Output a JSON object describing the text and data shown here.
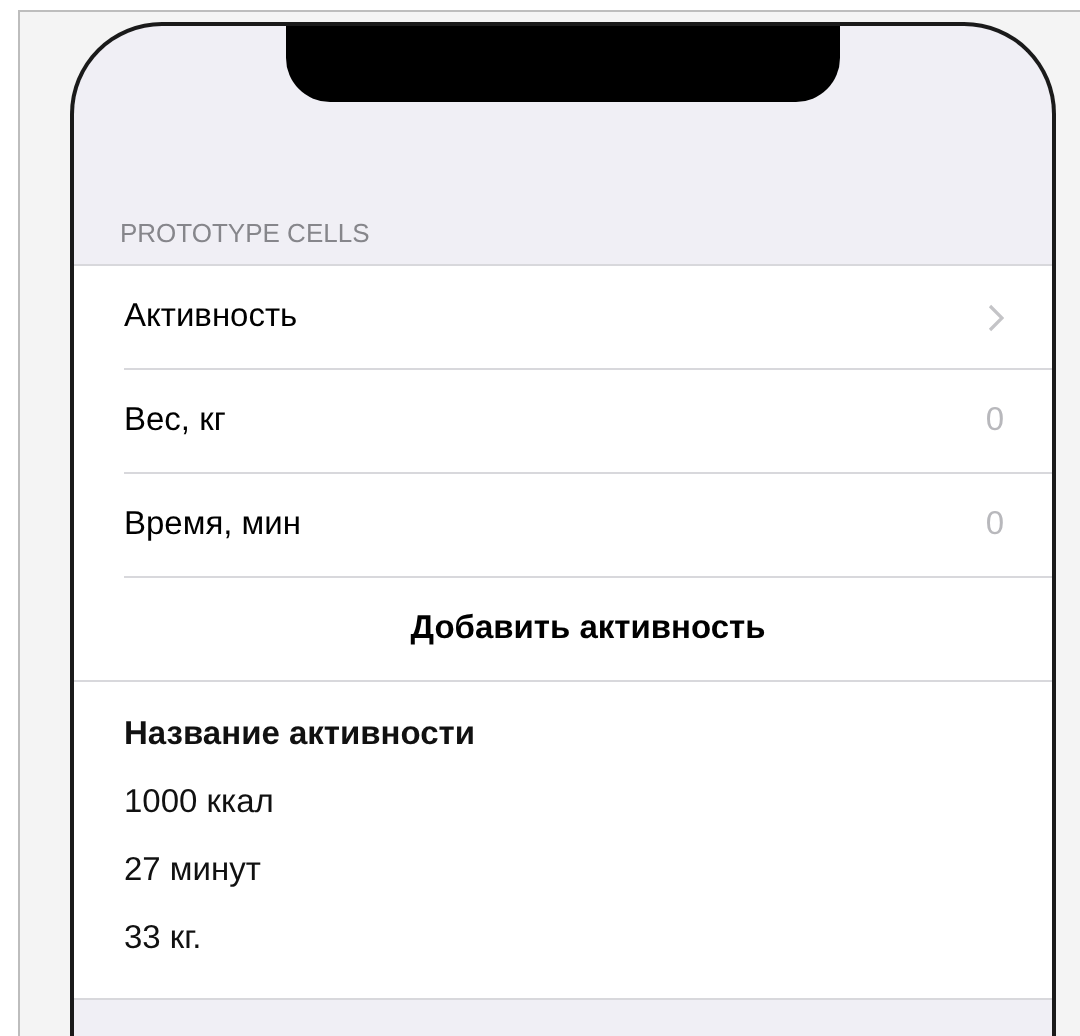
{
  "section_header": "PROTOTYPE CELLS",
  "rows": [
    {
      "kind": "disclosure",
      "label": "Активность"
    },
    {
      "kind": "value",
      "label": "Вес, кг",
      "value": "0"
    },
    {
      "kind": "value",
      "label": "Время, мин",
      "value": "0"
    },
    {
      "kind": "button",
      "label": "Добавить активность"
    },
    {
      "kind": "detail",
      "title": "Название активности",
      "lines": [
        "1000 ккал",
        "27 минут",
        "33 кг."
      ]
    }
  ]
}
